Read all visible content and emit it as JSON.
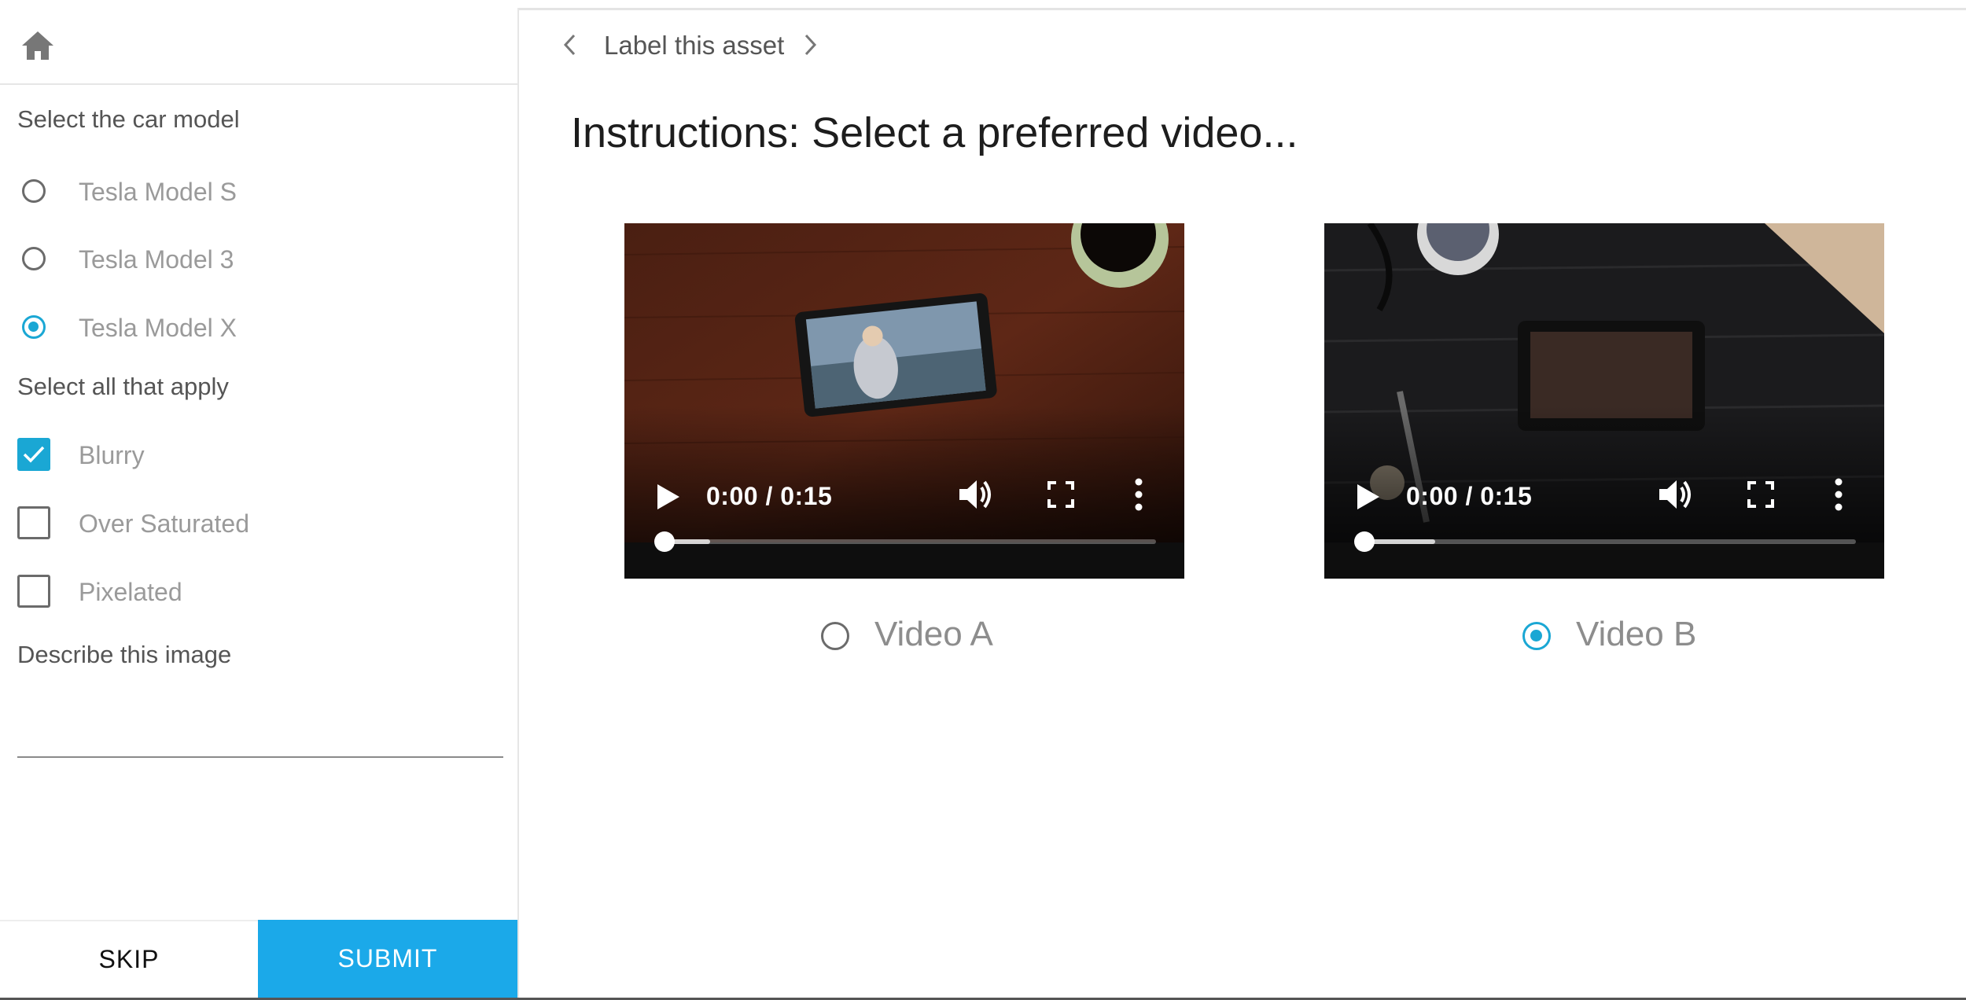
{
  "sidebar": {
    "car_model": {
      "title": "Select the car model",
      "options": [
        {
          "label": "Tesla Model S",
          "selected": false
        },
        {
          "label": "Tesla Model 3",
          "selected": false
        },
        {
          "label": "Tesla Model X",
          "selected": true
        }
      ]
    },
    "attributes": {
      "title": "Select all that apply",
      "options": [
        {
          "label": "Blurry",
          "checked": true
        },
        {
          "label": "Over Saturated",
          "checked": false
        },
        {
          "label": "Pixelated",
          "checked": false
        }
      ]
    },
    "describe": {
      "title": "Describe this image",
      "value": ""
    },
    "skip_label": "SKIP",
    "submit_label": "SUBMIT"
  },
  "main": {
    "breadcrumb": "Label this asset",
    "instructions": "Instructions: Select a preferred video...",
    "videos": [
      {
        "choice_label": "Video A",
        "time": "0:00 / 0:15",
        "progress": 0.1,
        "selected": false
      },
      {
        "choice_label": "Video B",
        "time": "0:00 / 0:15",
        "progress": 0.15,
        "selected": true
      }
    ]
  },
  "colors": {
    "accent": "#1aa7d4",
    "submit": "#1ba9e9"
  },
  "icons": [
    "home-icon",
    "chevron-left-icon",
    "chevron-right-icon",
    "play-icon",
    "volume-icon",
    "fullscreen-icon",
    "more-vert-icon",
    "checkmark-icon"
  ]
}
